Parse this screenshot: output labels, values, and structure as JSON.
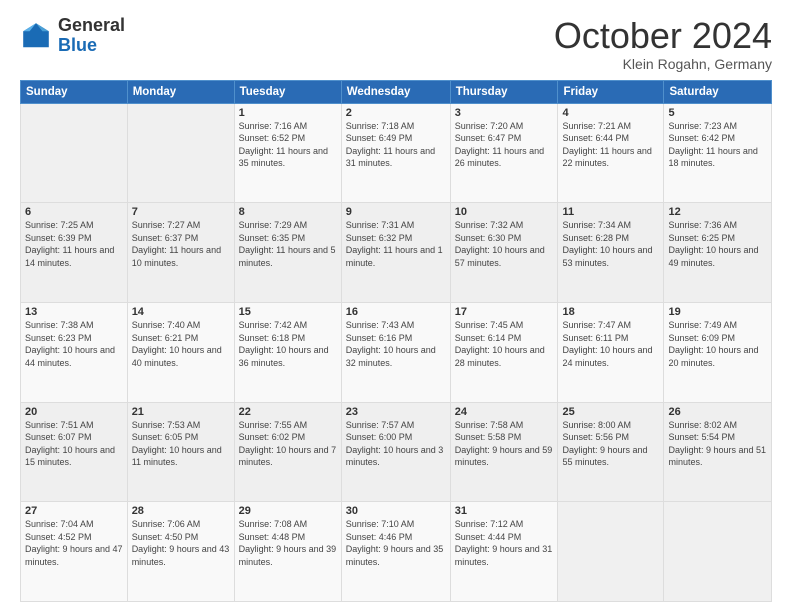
{
  "logo": {
    "general": "General",
    "blue": "Blue"
  },
  "header": {
    "month": "October 2024",
    "location": "Klein Rogahn, Germany"
  },
  "weekdays": [
    "Sunday",
    "Monday",
    "Tuesday",
    "Wednesday",
    "Thursday",
    "Friday",
    "Saturday"
  ],
  "weeks": [
    [
      {
        "day": "",
        "detail": ""
      },
      {
        "day": "",
        "detail": ""
      },
      {
        "day": "1",
        "detail": "Sunrise: 7:16 AM\nSunset: 6:52 PM\nDaylight: 11 hours and 35 minutes."
      },
      {
        "day": "2",
        "detail": "Sunrise: 7:18 AM\nSunset: 6:49 PM\nDaylight: 11 hours and 31 minutes."
      },
      {
        "day": "3",
        "detail": "Sunrise: 7:20 AM\nSunset: 6:47 PM\nDaylight: 11 hours and 26 minutes."
      },
      {
        "day": "4",
        "detail": "Sunrise: 7:21 AM\nSunset: 6:44 PM\nDaylight: 11 hours and 22 minutes."
      },
      {
        "day": "5",
        "detail": "Sunrise: 7:23 AM\nSunset: 6:42 PM\nDaylight: 11 hours and 18 minutes."
      }
    ],
    [
      {
        "day": "6",
        "detail": "Sunrise: 7:25 AM\nSunset: 6:39 PM\nDaylight: 11 hours and 14 minutes."
      },
      {
        "day": "7",
        "detail": "Sunrise: 7:27 AM\nSunset: 6:37 PM\nDaylight: 11 hours and 10 minutes."
      },
      {
        "day": "8",
        "detail": "Sunrise: 7:29 AM\nSunset: 6:35 PM\nDaylight: 11 hours and 5 minutes."
      },
      {
        "day": "9",
        "detail": "Sunrise: 7:31 AM\nSunset: 6:32 PM\nDaylight: 11 hours and 1 minute."
      },
      {
        "day": "10",
        "detail": "Sunrise: 7:32 AM\nSunset: 6:30 PM\nDaylight: 10 hours and 57 minutes."
      },
      {
        "day": "11",
        "detail": "Sunrise: 7:34 AM\nSunset: 6:28 PM\nDaylight: 10 hours and 53 minutes."
      },
      {
        "day": "12",
        "detail": "Sunrise: 7:36 AM\nSunset: 6:25 PM\nDaylight: 10 hours and 49 minutes."
      }
    ],
    [
      {
        "day": "13",
        "detail": "Sunrise: 7:38 AM\nSunset: 6:23 PM\nDaylight: 10 hours and 44 minutes."
      },
      {
        "day": "14",
        "detail": "Sunrise: 7:40 AM\nSunset: 6:21 PM\nDaylight: 10 hours and 40 minutes."
      },
      {
        "day": "15",
        "detail": "Sunrise: 7:42 AM\nSunset: 6:18 PM\nDaylight: 10 hours and 36 minutes."
      },
      {
        "day": "16",
        "detail": "Sunrise: 7:43 AM\nSunset: 6:16 PM\nDaylight: 10 hours and 32 minutes."
      },
      {
        "day": "17",
        "detail": "Sunrise: 7:45 AM\nSunset: 6:14 PM\nDaylight: 10 hours and 28 minutes."
      },
      {
        "day": "18",
        "detail": "Sunrise: 7:47 AM\nSunset: 6:11 PM\nDaylight: 10 hours and 24 minutes."
      },
      {
        "day": "19",
        "detail": "Sunrise: 7:49 AM\nSunset: 6:09 PM\nDaylight: 10 hours and 20 minutes."
      }
    ],
    [
      {
        "day": "20",
        "detail": "Sunrise: 7:51 AM\nSunset: 6:07 PM\nDaylight: 10 hours and 15 minutes."
      },
      {
        "day": "21",
        "detail": "Sunrise: 7:53 AM\nSunset: 6:05 PM\nDaylight: 10 hours and 11 minutes."
      },
      {
        "day": "22",
        "detail": "Sunrise: 7:55 AM\nSunset: 6:02 PM\nDaylight: 10 hours and 7 minutes."
      },
      {
        "day": "23",
        "detail": "Sunrise: 7:57 AM\nSunset: 6:00 PM\nDaylight: 10 hours and 3 minutes."
      },
      {
        "day": "24",
        "detail": "Sunrise: 7:58 AM\nSunset: 5:58 PM\nDaylight: 9 hours and 59 minutes."
      },
      {
        "day": "25",
        "detail": "Sunrise: 8:00 AM\nSunset: 5:56 PM\nDaylight: 9 hours and 55 minutes."
      },
      {
        "day": "26",
        "detail": "Sunrise: 8:02 AM\nSunset: 5:54 PM\nDaylight: 9 hours and 51 minutes."
      }
    ],
    [
      {
        "day": "27",
        "detail": "Sunrise: 7:04 AM\nSunset: 4:52 PM\nDaylight: 9 hours and 47 minutes."
      },
      {
        "day": "28",
        "detail": "Sunrise: 7:06 AM\nSunset: 4:50 PM\nDaylight: 9 hours and 43 minutes."
      },
      {
        "day": "29",
        "detail": "Sunrise: 7:08 AM\nSunset: 4:48 PM\nDaylight: 9 hours and 39 minutes."
      },
      {
        "day": "30",
        "detail": "Sunrise: 7:10 AM\nSunset: 4:46 PM\nDaylight: 9 hours and 35 minutes."
      },
      {
        "day": "31",
        "detail": "Sunrise: 7:12 AM\nSunset: 4:44 PM\nDaylight: 9 hours and 31 minutes."
      },
      {
        "day": "",
        "detail": ""
      },
      {
        "day": "",
        "detail": ""
      }
    ]
  ]
}
